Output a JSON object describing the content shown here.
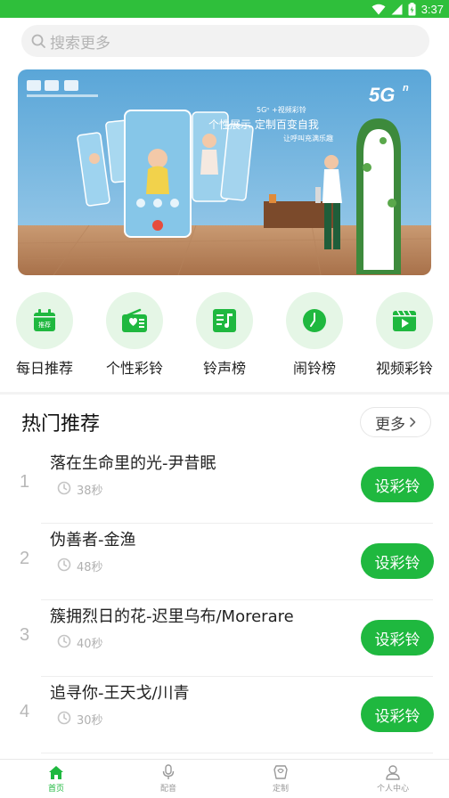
{
  "status_bar": {
    "time": "3:37"
  },
  "search": {
    "placeholder": "搜索更多"
  },
  "banner": {
    "brand_5g": "5G",
    "brand_sup": "n",
    "headline_small": "5Gⁿ +视频彩铃",
    "headline": "个性展示 定制百变自我",
    "subline": "让呼叫充满乐趣"
  },
  "categories": [
    {
      "label": "每日推荐",
      "icon": "calendar-icon",
      "badge": "推荐"
    },
    {
      "label": "个性彩铃",
      "icon": "radio-heart-icon"
    },
    {
      "label": "铃声榜",
      "icon": "music-list-icon"
    },
    {
      "label": "闹铃榜",
      "icon": "clock-icon"
    },
    {
      "label": "视频彩铃",
      "icon": "video-play-icon"
    }
  ],
  "hot": {
    "title": "热门推荐",
    "more_label": "更多",
    "songs": [
      {
        "index": "1",
        "title": "落在生命里的光-尹昔眠",
        "duration": "38秒",
        "action": "设彩铃"
      },
      {
        "index": "2",
        "title": "伪善者-金渔",
        "duration": "48秒",
        "action": "设彩铃"
      },
      {
        "index": "3",
        "title": "簇拥烈日的花-迟里乌布/Morerare",
        "duration": "40秒",
        "action": "设彩铃"
      },
      {
        "index": "4",
        "title": "追寻你-王天戈/川青",
        "duration": "30秒",
        "action": "设彩铃"
      }
    ]
  },
  "tabs": [
    {
      "label": "首页",
      "icon": "home-icon",
      "active": true
    },
    {
      "label": "配音",
      "icon": "microphone-icon",
      "active": false
    },
    {
      "label": "定制",
      "icon": "customize-icon",
      "active": false
    },
    {
      "label": "个人中心",
      "icon": "user-icon",
      "active": false
    }
  ],
  "colors": {
    "accent": "#1fb83f",
    "status_bar": "#2fbf3b",
    "category_bg": "#e5f6e6"
  }
}
